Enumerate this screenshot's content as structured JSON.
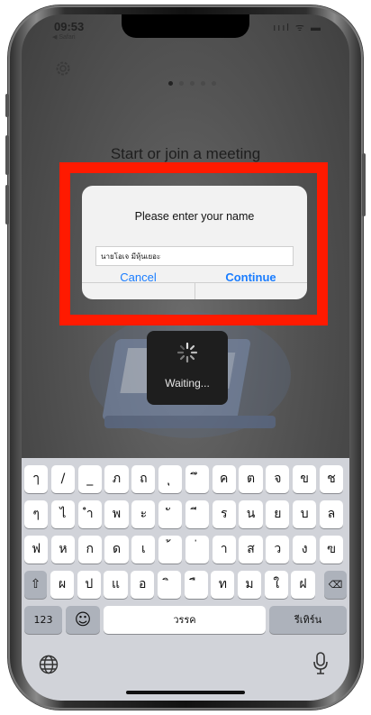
{
  "status_bar": {
    "time": "09:53",
    "back_app": "◀ Safari",
    "icons": "ıııl ᯤ ▬"
  },
  "pager": {
    "count": 5,
    "active": 0
  },
  "headline": "Start or join a meeting",
  "alert": {
    "title": "Please enter your name",
    "input_value": "นายโอเจ มีหุ้นเยอะ",
    "cancel_label": "Cancel",
    "continue_label": "Continue"
  },
  "waiting": {
    "label": "Waiting..."
  },
  "keyboard": {
    "row1": [
      "ๅ",
      "/",
      "_",
      "ภ",
      "ถ",
      "ุ",
      "ึ",
      "ค",
      "ต",
      "จ",
      "ข",
      "ช"
    ],
    "row2": [
      "ๆ",
      "ไ",
      "ำ",
      "พ",
      "ะ",
      "ั",
      "ี",
      "ร",
      "น",
      "ย",
      "บ",
      "ล"
    ],
    "row3": [
      "ฟ",
      "ห",
      "ก",
      "ด",
      "เ",
      "้",
      "่",
      "า",
      "ส",
      "ว",
      "ง",
      "ฃ"
    ],
    "row4": [
      "ผ",
      "ป",
      "แ",
      "อ",
      "ิ",
      "ื",
      "ท",
      "ม",
      "ใ",
      "ฝ"
    ],
    "shift_glyph": "⇧",
    "delete_glyph": "⌫",
    "numbers_label": "123",
    "emoji_glyph": "☺",
    "space_label": "วรรค",
    "return_label": "รีเทิร์น"
  },
  "colors": {
    "highlight": "#ff1a00",
    "accent": "#1a7dff"
  }
}
